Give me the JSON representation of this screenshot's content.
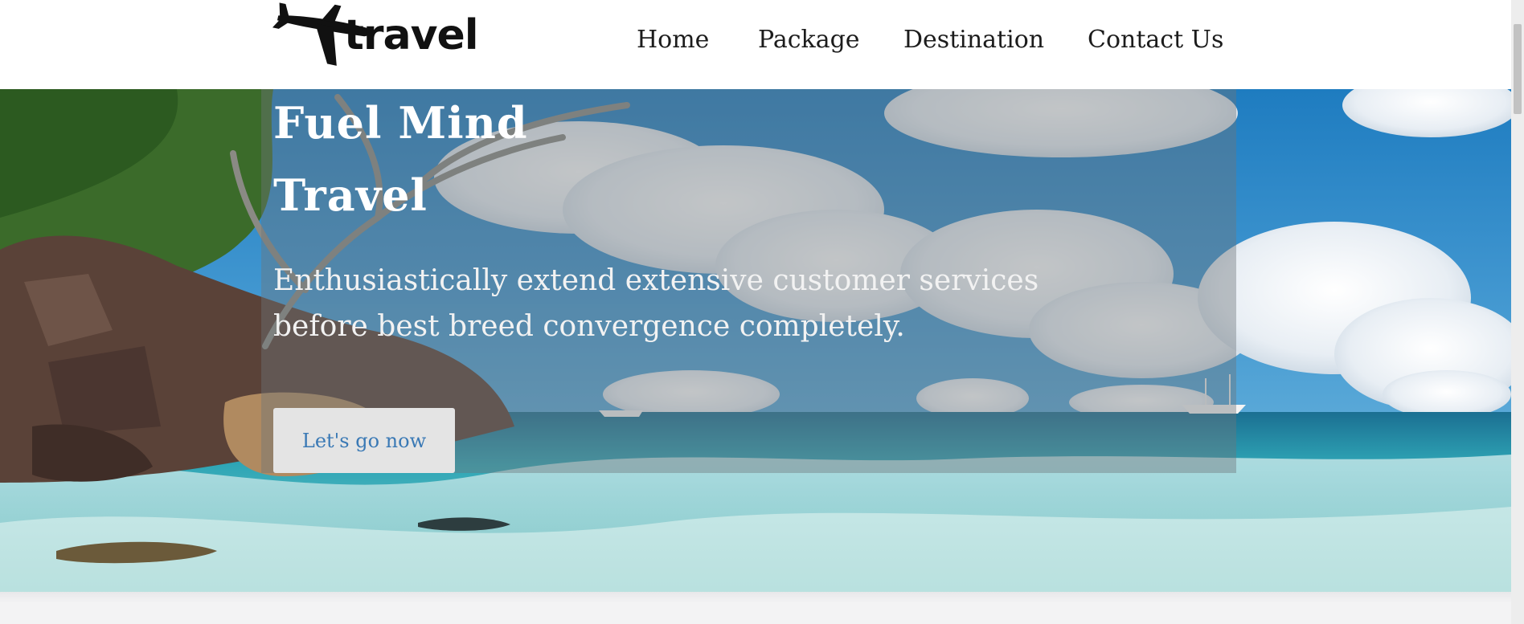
{
  "brand": {
    "logo_icon": "airplane-icon",
    "name": "travel"
  },
  "nav": {
    "items": [
      {
        "label": "Home"
      },
      {
        "label": "Package"
      },
      {
        "label": "Destination"
      },
      {
        "label": "Contact Us"
      }
    ]
  },
  "hero": {
    "title_line1": "Fuel Mind",
    "title_line2": "Travel",
    "subtitle": "Enthusiastically extend extensive customer services before best breed convergence completely.",
    "cta_label": "Let's go now",
    "background": "tropical-beach-photo"
  },
  "colors": {
    "cta_text": "#3a79b5",
    "header_bg": "#ffffff",
    "overlay": "rgba(110,116,122,0.42)"
  }
}
